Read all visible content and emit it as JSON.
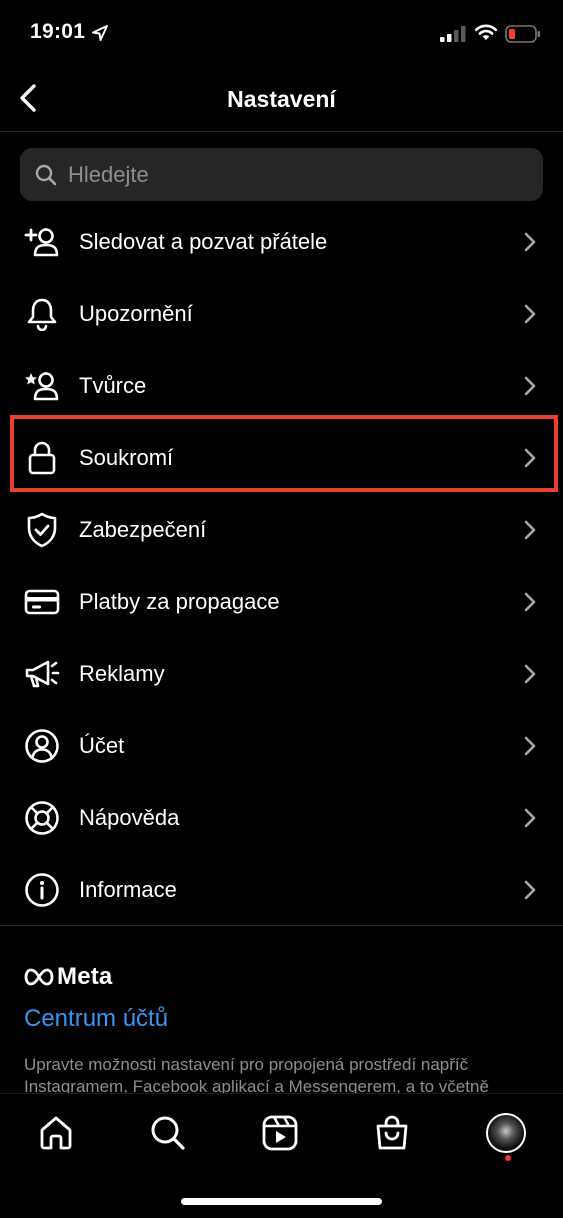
{
  "status_bar": {
    "time": "19:01",
    "battery_color": "#ff3b30"
  },
  "header": {
    "title": "Nastavení",
    "back_icon": "chevron-left-icon"
  },
  "search": {
    "placeholder": "Hledejte",
    "value": ""
  },
  "menu": {
    "items": [
      {
        "label": "Sledovat a pozvat přátele",
        "icon": "add-person-icon"
      },
      {
        "label": "Upozornění",
        "icon": "bell-icon"
      },
      {
        "label": "Tvůrce",
        "icon": "creator-star-person-icon"
      },
      {
        "label": "Soukromí",
        "icon": "lock-icon",
        "highlighted": true
      },
      {
        "label": "Zabezpečení",
        "icon": "shield-check-icon"
      },
      {
        "label": "Platby za propagace",
        "icon": "credit-card-icon"
      },
      {
        "label": "Reklamy",
        "icon": "megaphone-icon"
      },
      {
        "label": "Účet",
        "icon": "account-circle-icon"
      },
      {
        "label": "Nápověda",
        "icon": "lifebuoy-icon"
      },
      {
        "label": "Informace",
        "icon": "info-icon"
      }
    ],
    "highlight_color": "#e8402e"
  },
  "meta": {
    "brand": "Meta",
    "accounts_center": "Centrum účtů",
    "accounts_center_color": "#3797f0",
    "description": "Upravte možnosti nastavení pro propojená prostředí napříč Instagramem, Facebook aplikací a Messengerem, a to včetně"
  },
  "tab_bar": {
    "tabs": [
      "home-icon",
      "search-icon",
      "reels-icon",
      "shop-bag-icon",
      "profile-avatar"
    ],
    "notification_dot_color": "#ff3040"
  }
}
